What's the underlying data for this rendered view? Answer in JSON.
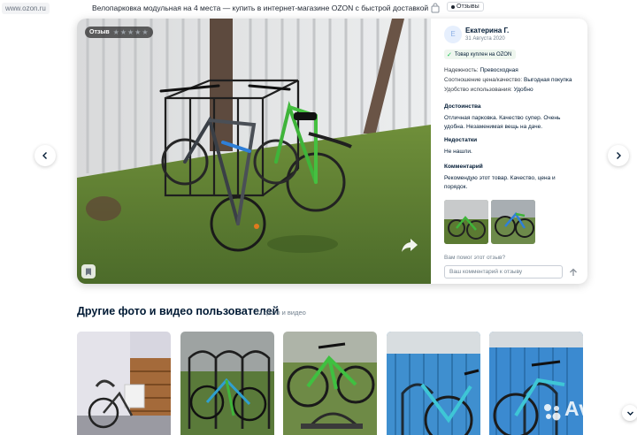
{
  "browser": {
    "url": "www.ozon.ru",
    "page_title": "Велопарковка модульная на 4 места — купить в интернет-магазине OZON с быстрой доставкой",
    "reviews_chip": "Отзывы"
  },
  "review": {
    "badge_label": "Отзыв",
    "rating": 5,
    "avatar_letter": "Е",
    "author": "Екатерина Г.",
    "date": "31 Августа 2020",
    "verified": "Товар куплен на OZON",
    "attributes": [
      {
        "key": "Надежность:",
        "value": "Превосходная"
      },
      {
        "key": "Соотношение цена/качество:",
        "value": "Выгодная покупка"
      },
      {
        "key": "Удобство использования:",
        "value": "Удобно"
      }
    ],
    "pros_title": "Достоинства",
    "pros_text": "Отличная парковка. Качество супер. Очень удобна. Незаменимая вещь на даче.",
    "cons_title": "Недостатки",
    "cons_text": "Не нашли.",
    "comment_title": "Комментарий",
    "comment_text": "Рекомендую этот товар. Качество, цена и порядок.",
    "helpful_question": "Вам помог этот отзыв?",
    "comment_placeholder": "Ваш комментарий к отзыву"
  },
  "other": {
    "title": "Другие фото и видео пользователей",
    "count": "11 фото и видео"
  },
  "watermark": "Avito",
  "colors": {
    "ozon_blue": "#005bff",
    "text": "#001a34",
    "muted": "#707f8d",
    "verified_green": "#10c44c",
    "star_gray": "#9aa0a6"
  },
  "icons": [
    "share-icon",
    "bookmark-icon",
    "send-icon",
    "chevron-left-icon",
    "chevron-right-icon",
    "chevron-down-icon",
    "check-icon",
    "star-icon"
  ]
}
